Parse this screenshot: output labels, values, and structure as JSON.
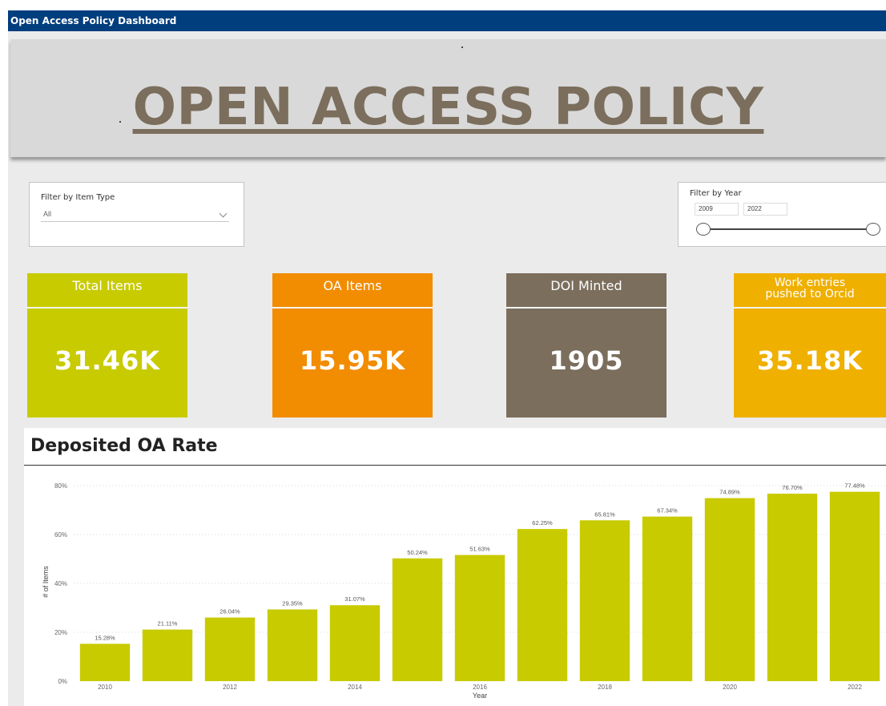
{
  "app": {
    "title": "Open Access Policy Dashboard"
  },
  "banner": {
    "title": "OPEN ACCESS POLICY"
  },
  "filters": {
    "item_type": {
      "label": "Filter by Item Type",
      "value": "All"
    },
    "year": {
      "label": "Filter by Year",
      "from": "2009",
      "to": "2022"
    }
  },
  "kpis": [
    {
      "title": "Total Items",
      "value": "31.46K",
      "color": "#c8cb00"
    },
    {
      "title": "OA Items",
      "value": "15.95K",
      "color": "#f28c00"
    },
    {
      "title": "DOI Minted",
      "value": "1905",
      "color": "#7b6e5c"
    },
    {
      "title": "Work entries pushed to Orcid",
      "title_line1": "Work entries",
      "title_line2": "pushed to Orcid",
      "value": "35.18K",
      "color": "#efb000"
    }
  ],
  "chart": {
    "title": "Deposited OA Rate"
  },
  "chart_data": {
    "type": "bar",
    "title": "Deposited OA Rate",
    "xlabel": "Year",
    "ylabel": "# of Items",
    "categories": [
      "2010",
      "2011",
      "2012",
      "2013",
      "2014",
      "2015",
      "2016",
      "2017",
      "2018",
      "2019",
      "2020",
      "2021",
      "2022"
    ],
    "x_tick_labels": [
      "2010",
      "",
      "2012",
      "",
      "2014",
      "",
      "2016",
      "",
      "2018",
      "",
      "2020",
      "",
      "2022"
    ],
    "values": [
      15.28,
      21.11,
      26.04,
      29.35,
      31.07,
      50.24,
      51.63,
      62.25,
      65.81,
      67.34,
      74.89,
      76.7,
      77.48
    ],
    "data_labels": [
      "15.28%",
      "21.11%",
      "26.04%",
      "29.35%",
      "31.07%",
      "50.24%",
      "51.63%",
      "62.25%",
      "65.81%",
      "67.34%",
      "74.89%",
      "76.70%",
      "77.48%"
    ],
    "y_ticks": [
      "0%",
      "20%",
      "40%",
      "60%",
      "80%"
    ],
    "ylim": [
      0,
      80
    ],
    "grid": true,
    "bar_color": "#c8cb00"
  }
}
